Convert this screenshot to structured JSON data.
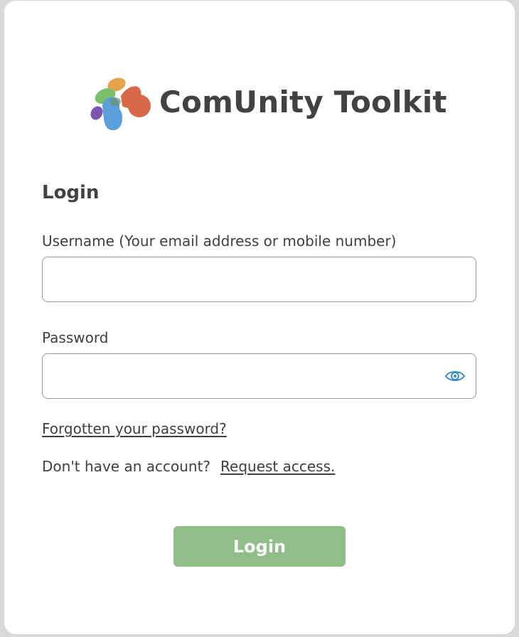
{
  "brand": {
    "name": "ComUnity Toolkit",
    "logo_icon": "comunity-logo-icon",
    "logo_colors": [
      "#e8a24c",
      "#7bbf6a",
      "#d9674a",
      "#5b9fde",
      "#7b55b0"
    ]
  },
  "form": {
    "heading": "Login",
    "username_label": "Username (Your email address or mobile number)",
    "username_value": "",
    "password_label": "Password",
    "password_value": "",
    "show_password_icon": "eye-icon",
    "forgot_link": "Forgotten your password?",
    "no_account_text": "Don't have an account?",
    "request_access_link": "Request access.",
    "submit_label": "Login"
  },
  "colors": {
    "login_button": "#8fbe88",
    "eye_icon": "#3a8fc9",
    "text": "#3f3f3f"
  }
}
